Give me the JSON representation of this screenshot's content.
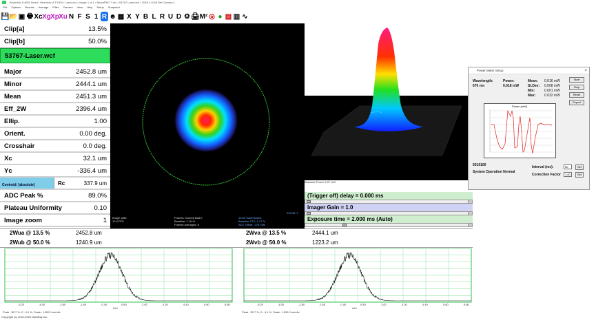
{
  "window": {
    "title": "BeamMic 8.4552 Read • BeamMic 8-F1000 / Laser.wcf • image 1 of 1 • BeamPMT 7.rev • 53767-Laser.wcf • 2048 x 2048 Ref  Camera 1"
  },
  "menu": [
    "File",
    "Options",
    "Results",
    "Average",
    "Filter",
    "Camera",
    "View",
    "Help",
    "Setup",
    "Snapshot"
  ],
  "toolbar": {
    "items": [
      {
        "icon": "save-icon",
        "glyph": "💾"
      },
      {
        "icon": "open-folder-icon",
        "glyph": "📂"
      },
      {
        "icon": "save-disk-icon",
        "glyph": "▣"
      },
      {
        "icon": "print-icon",
        "glyph": "🖶"
      },
      {
        "icon": "xc-label",
        "glyph": "Xc"
      },
      {
        "icon": "xg-label",
        "glyph": "Xg"
      },
      {
        "icon": "xp-label",
        "glyph": "Xp"
      },
      {
        "icon": "xu-label",
        "glyph": "Xu"
      },
      {
        "icon": "n-label",
        "glyph": "N"
      },
      {
        "icon": "f-label",
        "glyph": "F"
      },
      {
        "icon": "s-label",
        "glyph": "S"
      },
      {
        "icon": "one-label",
        "glyph": "1"
      },
      {
        "icon": "r-label",
        "glyph": "R"
      },
      {
        "icon": "person-icon",
        "glyph": "☻"
      },
      {
        "icon": "grid-icon",
        "glyph": "▦"
      },
      {
        "icon": "x-label",
        "glyph": "X"
      },
      {
        "icon": "y-label",
        "glyph": "Y"
      },
      {
        "icon": "b-label",
        "glyph": "B"
      },
      {
        "icon": "l-label",
        "glyph": "L"
      },
      {
        "icon": "r2-label",
        "glyph": "R"
      },
      {
        "icon": "u-label",
        "glyph": "U"
      },
      {
        "icon": "d-label",
        "glyph": "D"
      },
      {
        "icon": "gear-icon",
        "glyph": "⚙"
      },
      {
        "icon": "printer-icon",
        "glyph": "🖨"
      },
      {
        "icon": "m2-label",
        "glyph": "M²"
      },
      {
        "icon": "target-icon",
        "glyph": "◎"
      },
      {
        "icon": "power-icon",
        "glyph": "●"
      },
      {
        "icon": "chart-icon",
        "glyph": "▤"
      },
      {
        "icon": "bars-icon",
        "glyph": "▥"
      },
      {
        "icon": "waveform-icon",
        "glyph": "∿"
      }
    ]
  },
  "left_panel": {
    "clip_a": {
      "label": "Clip[a]",
      "value": "13.5%"
    },
    "clip_b": {
      "label": "Clip[b]",
      "value": "50.0%"
    },
    "file": "53767-Laser.wcf",
    "rows": [
      {
        "label": "Major",
        "value": "2452.8 um"
      },
      {
        "label": "Minor",
        "value": "2444.1 um"
      },
      {
        "label": "Mean",
        "value": "2451.3 um"
      },
      {
        "label": "Eff_2W",
        "value": "2396.4 um"
      },
      {
        "label": "Ellip.",
        "value": "1.00"
      },
      {
        "label": "Orient.",
        "value": "0.00 deg."
      },
      {
        "label": "Crosshair",
        "value": "0.0 deg."
      },
      {
        "label": "Xc",
        "value": "32.1 um"
      },
      {
        "label": "Yc",
        "value": "-336.4 um"
      }
    ],
    "centroid": {
      "label": "Centroid: [absolute]",
      "rc_label": "Rc",
      "rc_value": "337.9 um"
    },
    "rows2": [
      {
        "label": "ADC Peak %",
        "value": "89.0%"
      },
      {
        "label": "Plateau Uniformity",
        "value": "0.10"
      },
      {
        "label": "Image zoom",
        "value": "1"
      }
    ]
  },
  "beam_view": {
    "footer_left": [
      "Image valid",
      "10.3 FPS"
    ],
    "footer_mid": [
      "Frames: Good:8 Bad:0",
      "Baseline: 1.18 %",
      "Frames averaged: 8"
    ],
    "footer_right": [
      "10-bit SuperSpeed",
      "Baseline STD: 0.27 %",
      "ADC Offset: -378 Offs"
    ],
    "zoom": "ZOOM: 1"
  },
  "absolute_power": "Absolute Power 0.87 mW",
  "power_meter": {
    "title": "Power Meter Setup",
    "wavelength_label": "Wavelength:",
    "wavelength_value": "670 nm",
    "power_label": "Power:",
    "power_value": "0.018 mW",
    "mean_label": "Mean:",
    "mean_value": "0.016 mW",
    "stdev_label": "St.Dev:",
    "stdev_value": "0.008 mW",
    "min_label": "Min:",
    "min_value": "0.001 mW",
    "max_label": "Max:",
    "max_value": "0.032 mW",
    "buttons": [
      "Start",
      "Stop",
      "Reset",
      "Export"
    ],
    "plot_title": "Power (mW)",
    "serial": "5019100",
    "status": "System Operation Normal",
    "interval_label": "Interval (ms):",
    "interval_value": "50",
    "correction_label": "Correction Factor",
    "correction_value": "1.00",
    "set_label": "Set"
  },
  "controls": {
    "trigger": "(Trigger off) delay = 0.000 ms",
    "gain": "Imager Gain = 1.0",
    "exposure": "Exposure time = 2.000 ms (Auto)"
  },
  "widths": {
    "wua_label": "2Wua @ 13.5 %",
    "wua_value": "2452.8 um",
    "wub_label": "2Wub @ 50.0 %",
    "wub_value": "1240.9 um",
    "wva_label": "2Wva @ 13.5 %",
    "wva_value": "2444.1 um",
    "wvb_label": "2Wvb @ 50.0 %",
    "wvb_value": "1223.2 um"
  },
  "profile_left": {
    "ticks": [
      "-5.20",
      "-4.00",
      "-2.80",
      "-1.60",
      "-0.40",
      "0.80",
      "2.00",
      "3.20",
      "4.40",
      "5.60",
      "6.80"
    ],
    "unit": "mm",
    "caption": "Peak : 50.7 %, 0 : 4.1 %, Scale : 1200.0 um/div"
  },
  "profile_right": {
    "ticks": [
      "-5.20",
      "-4.00",
      "-2.80",
      "-1.60",
      "-0.40",
      "0.80",
      "2.00",
      "3.20",
      "4.40",
      "5.60",
      "6.80"
    ],
    "unit": "mm",
    "caption": "Peak : 50.7 %, 0 : 4.1 %, Scale : 1200.0 um/div"
  },
  "statusbar": "Copyright (c) 2002-2020 DataRay Inc."
}
